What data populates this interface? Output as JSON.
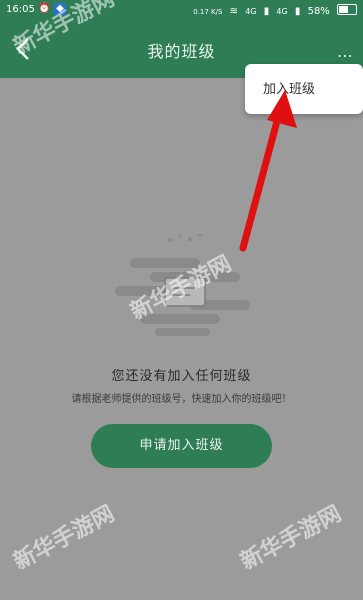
{
  "status_bar": {
    "time": "16:05",
    "network_speed": "0.17 K/S",
    "signal_4g_a": "4G",
    "signal_4g_b": "4G",
    "battery": "58%",
    "battery_level": 0.58
  },
  "app_bar": {
    "title": "我的班级",
    "more_label": "⋯"
  },
  "popup_menu": {
    "items": [
      {
        "label": "加入班级"
      }
    ]
  },
  "empty_state": {
    "title": "您还没有加入任何班级",
    "subtitle": "请根据老师提供的班级号，快速加入你的班级吧！"
  },
  "apply_button": {
    "label": "申请加入班级"
  },
  "watermarks": [
    "新华手游网",
    "新华手游网",
    "新华手游网",
    "新华手游网"
  ],
  "colors": {
    "primary": "#2f7d55",
    "overlay_background": "#9b9b9b",
    "annotation_arrow": "#e01010"
  }
}
